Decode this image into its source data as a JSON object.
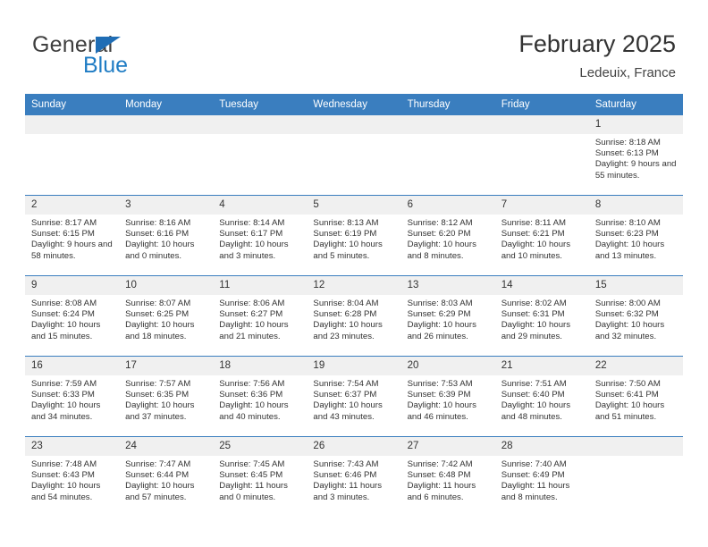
{
  "brand": {
    "line1": "General",
    "line2": "Blue",
    "triangle_color": "#1f6db5",
    "blue_color": "#1f7cc4"
  },
  "header": {
    "title": "February 2025",
    "subtitle": "Ledeuix, France"
  },
  "theme": {
    "header_blue": "#3a7ebf",
    "daynum_bg": "#f0f0f0",
    "text": "#333333"
  },
  "calendar": {
    "weekday_headers": [
      "Sunday",
      "Monday",
      "Tuesday",
      "Wednesday",
      "Thursday",
      "Friday",
      "Saturday"
    ],
    "weeks": [
      [
        {
          "day": "",
          "empty": true
        },
        {
          "day": "",
          "empty": true
        },
        {
          "day": "",
          "empty": true
        },
        {
          "day": "",
          "empty": true
        },
        {
          "day": "",
          "empty": true
        },
        {
          "day": "",
          "empty": true
        },
        {
          "day": "1",
          "sunrise": "Sunrise: 8:18 AM",
          "sunset": "Sunset: 6:13 PM",
          "daylight": "Daylight: 9 hours and 55 minutes."
        }
      ],
      [
        {
          "day": "2",
          "sunrise": "Sunrise: 8:17 AM",
          "sunset": "Sunset: 6:15 PM",
          "daylight": "Daylight: 9 hours and 58 minutes."
        },
        {
          "day": "3",
          "sunrise": "Sunrise: 8:16 AM",
          "sunset": "Sunset: 6:16 PM",
          "daylight": "Daylight: 10 hours and 0 minutes."
        },
        {
          "day": "4",
          "sunrise": "Sunrise: 8:14 AM",
          "sunset": "Sunset: 6:17 PM",
          "daylight": "Daylight: 10 hours and 3 minutes."
        },
        {
          "day": "5",
          "sunrise": "Sunrise: 8:13 AM",
          "sunset": "Sunset: 6:19 PM",
          "daylight": "Daylight: 10 hours and 5 minutes."
        },
        {
          "day": "6",
          "sunrise": "Sunrise: 8:12 AM",
          "sunset": "Sunset: 6:20 PM",
          "daylight": "Daylight: 10 hours and 8 minutes."
        },
        {
          "day": "7",
          "sunrise": "Sunrise: 8:11 AM",
          "sunset": "Sunset: 6:21 PM",
          "daylight": "Daylight: 10 hours and 10 minutes."
        },
        {
          "day": "8",
          "sunrise": "Sunrise: 8:10 AM",
          "sunset": "Sunset: 6:23 PM",
          "daylight": "Daylight: 10 hours and 13 minutes."
        }
      ],
      [
        {
          "day": "9",
          "sunrise": "Sunrise: 8:08 AM",
          "sunset": "Sunset: 6:24 PM",
          "daylight": "Daylight: 10 hours and 15 minutes."
        },
        {
          "day": "10",
          "sunrise": "Sunrise: 8:07 AM",
          "sunset": "Sunset: 6:25 PM",
          "daylight": "Daylight: 10 hours and 18 minutes."
        },
        {
          "day": "11",
          "sunrise": "Sunrise: 8:06 AM",
          "sunset": "Sunset: 6:27 PM",
          "daylight": "Daylight: 10 hours and 21 minutes."
        },
        {
          "day": "12",
          "sunrise": "Sunrise: 8:04 AM",
          "sunset": "Sunset: 6:28 PM",
          "daylight": "Daylight: 10 hours and 23 minutes."
        },
        {
          "day": "13",
          "sunrise": "Sunrise: 8:03 AM",
          "sunset": "Sunset: 6:29 PM",
          "daylight": "Daylight: 10 hours and 26 minutes."
        },
        {
          "day": "14",
          "sunrise": "Sunrise: 8:02 AM",
          "sunset": "Sunset: 6:31 PM",
          "daylight": "Daylight: 10 hours and 29 minutes."
        },
        {
          "day": "15",
          "sunrise": "Sunrise: 8:00 AM",
          "sunset": "Sunset: 6:32 PM",
          "daylight": "Daylight: 10 hours and 32 minutes."
        }
      ],
      [
        {
          "day": "16",
          "sunrise": "Sunrise: 7:59 AM",
          "sunset": "Sunset: 6:33 PM",
          "daylight": "Daylight: 10 hours and 34 minutes."
        },
        {
          "day": "17",
          "sunrise": "Sunrise: 7:57 AM",
          "sunset": "Sunset: 6:35 PM",
          "daylight": "Daylight: 10 hours and 37 minutes."
        },
        {
          "day": "18",
          "sunrise": "Sunrise: 7:56 AM",
          "sunset": "Sunset: 6:36 PM",
          "daylight": "Daylight: 10 hours and 40 minutes."
        },
        {
          "day": "19",
          "sunrise": "Sunrise: 7:54 AM",
          "sunset": "Sunset: 6:37 PM",
          "daylight": "Daylight: 10 hours and 43 minutes."
        },
        {
          "day": "20",
          "sunrise": "Sunrise: 7:53 AM",
          "sunset": "Sunset: 6:39 PM",
          "daylight": "Daylight: 10 hours and 46 minutes."
        },
        {
          "day": "21",
          "sunrise": "Sunrise: 7:51 AM",
          "sunset": "Sunset: 6:40 PM",
          "daylight": "Daylight: 10 hours and 48 minutes."
        },
        {
          "day": "22",
          "sunrise": "Sunrise: 7:50 AM",
          "sunset": "Sunset: 6:41 PM",
          "daylight": "Daylight: 10 hours and 51 minutes."
        }
      ],
      [
        {
          "day": "23",
          "sunrise": "Sunrise: 7:48 AM",
          "sunset": "Sunset: 6:43 PM",
          "daylight": "Daylight: 10 hours and 54 minutes."
        },
        {
          "day": "24",
          "sunrise": "Sunrise: 7:47 AM",
          "sunset": "Sunset: 6:44 PM",
          "daylight": "Daylight: 10 hours and 57 minutes."
        },
        {
          "day": "25",
          "sunrise": "Sunrise: 7:45 AM",
          "sunset": "Sunset: 6:45 PM",
          "daylight": "Daylight: 11 hours and 0 minutes."
        },
        {
          "day": "26",
          "sunrise": "Sunrise: 7:43 AM",
          "sunset": "Sunset: 6:46 PM",
          "daylight": "Daylight: 11 hours and 3 minutes."
        },
        {
          "day": "27",
          "sunrise": "Sunrise: 7:42 AM",
          "sunset": "Sunset: 6:48 PM",
          "daylight": "Daylight: 11 hours and 6 minutes."
        },
        {
          "day": "28",
          "sunrise": "Sunrise: 7:40 AM",
          "sunset": "Sunset: 6:49 PM",
          "daylight": "Daylight: 11 hours and 8 minutes."
        },
        {
          "day": "",
          "empty": true
        }
      ]
    ]
  }
}
